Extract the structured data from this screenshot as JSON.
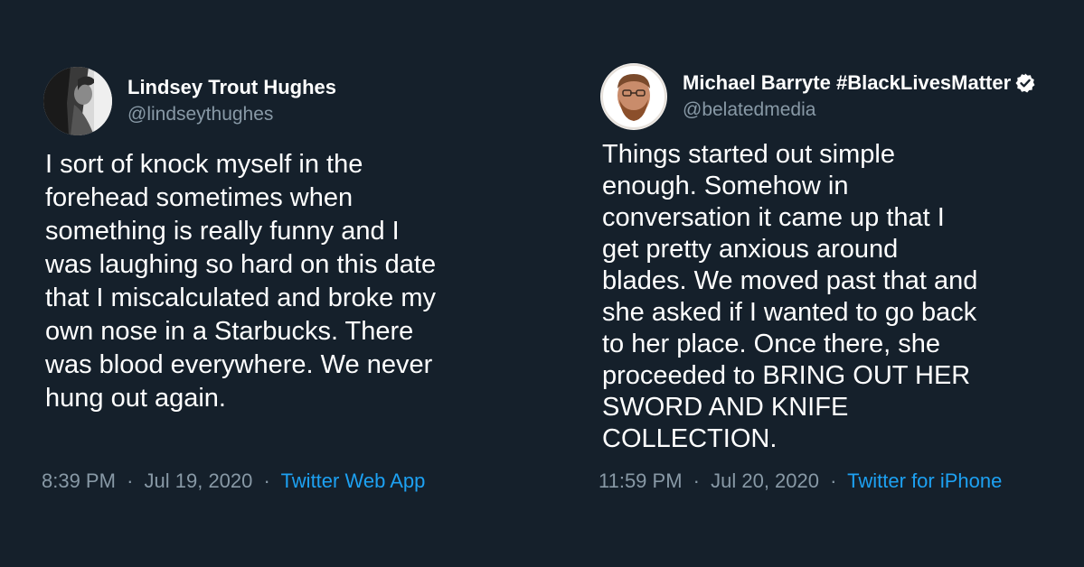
{
  "tweets": [
    {
      "display_name": "Lindsey Trout Hughes",
      "handle": "@lindseythughes",
      "verified": false,
      "text": "I sort of knock myself in the\nforehead sometimes when\nsomething is really funny and I\nwas laughing so hard on this date\nthat I miscalculated and broke my\nown nose in a Starbucks. There\nwas blood everywhere. We never\nhung out again.",
      "time": "8:39 PM",
      "date": "Jul 19, 2020",
      "separator": "·",
      "source": "Twitter Web App",
      "avatar_icon": "profile-photo-icon"
    },
    {
      "display_name": "Michael Barryte #BlackLivesMatter",
      "handle": "@belatedmedia",
      "verified": true,
      "text": "Things started out simple\nenough. Somehow in\nconversation it came up that I\nget pretty anxious around\nblades. We moved past that and\nshe asked if I wanted to go back\nto her place. Once there, she\nproceeded to BRING OUT HER\nSWORD AND KNIFE\nCOLLECTION.",
      "time": "11:59 PM",
      "date": "Jul 20, 2020",
      "separator": "·",
      "source": "Twitter for iPhone",
      "avatar_icon": "profile-photo-icon"
    }
  ],
  "colors": {
    "background": "#15202b",
    "text": "#ffffff",
    "secondary_text": "#8899a6",
    "link": "#1da1f2",
    "verified_badge": "#ffffff"
  }
}
